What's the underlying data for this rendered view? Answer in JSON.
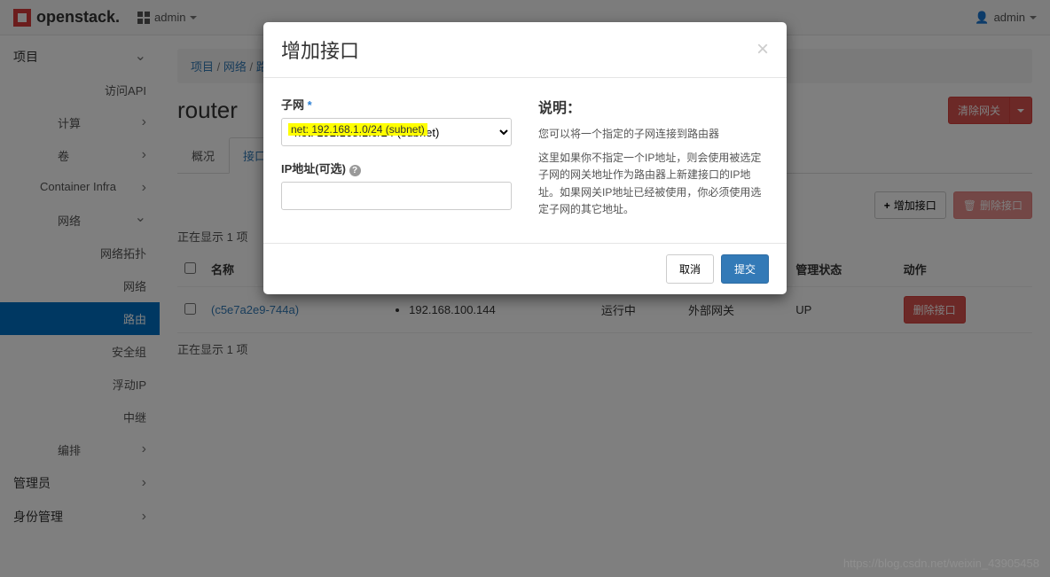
{
  "brand": "openstack.",
  "domain_selector": "admin",
  "user_menu": "admin",
  "sidebar": {
    "project": "项目",
    "access_api": "访问API",
    "compute": "计算",
    "volumes": "卷",
    "container_infra": "Container Infra",
    "network": "网络",
    "network_topology": "网络拓扑",
    "networks": "网络",
    "routers": "路由",
    "security_groups": "安全组",
    "floating_ips": "浮动IP",
    "trunks": "中继",
    "orchestration": "编排",
    "admin": "管理员",
    "identity": "身份管理"
  },
  "breadcrumb": {
    "project": "项目",
    "network": "网络",
    "routers": "路由"
  },
  "page_title": "router",
  "clear_gateway_btn": "清除网关",
  "tabs": {
    "overview": "概况",
    "interfaces": "接口"
  },
  "table_actions": {
    "add_interface": "增加接口",
    "delete_interface": "删除接口"
  },
  "table_info": "正在显示 1 项",
  "columns": {
    "name": "名称",
    "admin_state": "管理状态",
    "actions": "动作"
  },
  "row": {
    "name": "(c5e7a2e9-744a)",
    "fixed_ip": "192.168.100.144",
    "status": "运行中",
    "type": "外部网关",
    "admin_state": "UP",
    "action": "删除接口"
  },
  "modal": {
    "title": "增加接口",
    "subnet_label": "子网",
    "subnet_value": "net: 192.168.1.0/24 (subnet)",
    "ip_label": "IP地址(可选)",
    "desc_title": "说明：",
    "desc_line1": "您可以将一个指定的子网连接到路由器",
    "desc_line2": "这里如果你不指定一个IP地址，则会使用被选定子网的网关地址作为路由器上新建接口的IP地址。如果网关IP地址已经被使用，你必须使用选定子网的其它地址。",
    "cancel": "取消",
    "submit": "提交"
  },
  "watermark": "https://blog.csdn.net/weixin_43905458"
}
